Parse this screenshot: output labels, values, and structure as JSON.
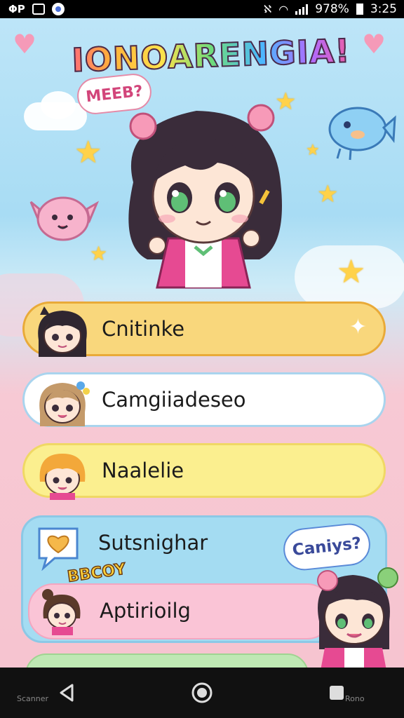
{
  "status_bar": {
    "battery": "978%",
    "time": "3:25"
  },
  "header": {
    "title": "IONOARENGIA!",
    "bubble": "MEEB?"
  },
  "menu": {
    "items": [
      {
        "label": "Cnitinke"
      },
      {
        "label": "Camgiiadeseo"
      },
      {
        "label": "Naalelie"
      },
      {
        "label": "Sutsnighar"
      },
      {
        "label": "Aptirioilg"
      }
    ],
    "speech_bubble": "Caniys?",
    "badge": "BBCOY"
  },
  "nav_bar": {
    "left_label": "Scanner",
    "right_label": "Rono"
  },
  "colors": {
    "item1": "#f9d77c",
    "item2": "#ffffff",
    "item3": "#fbef8f",
    "group": "#a4dcf2",
    "item5": "#fac4d6"
  },
  "icons": [
    "heart-icon",
    "star-icon",
    "back-icon",
    "home-icon",
    "recents-icon",
    "wifi-icon",
    "signal-icon",
    "battery-icon"
  ]
}
